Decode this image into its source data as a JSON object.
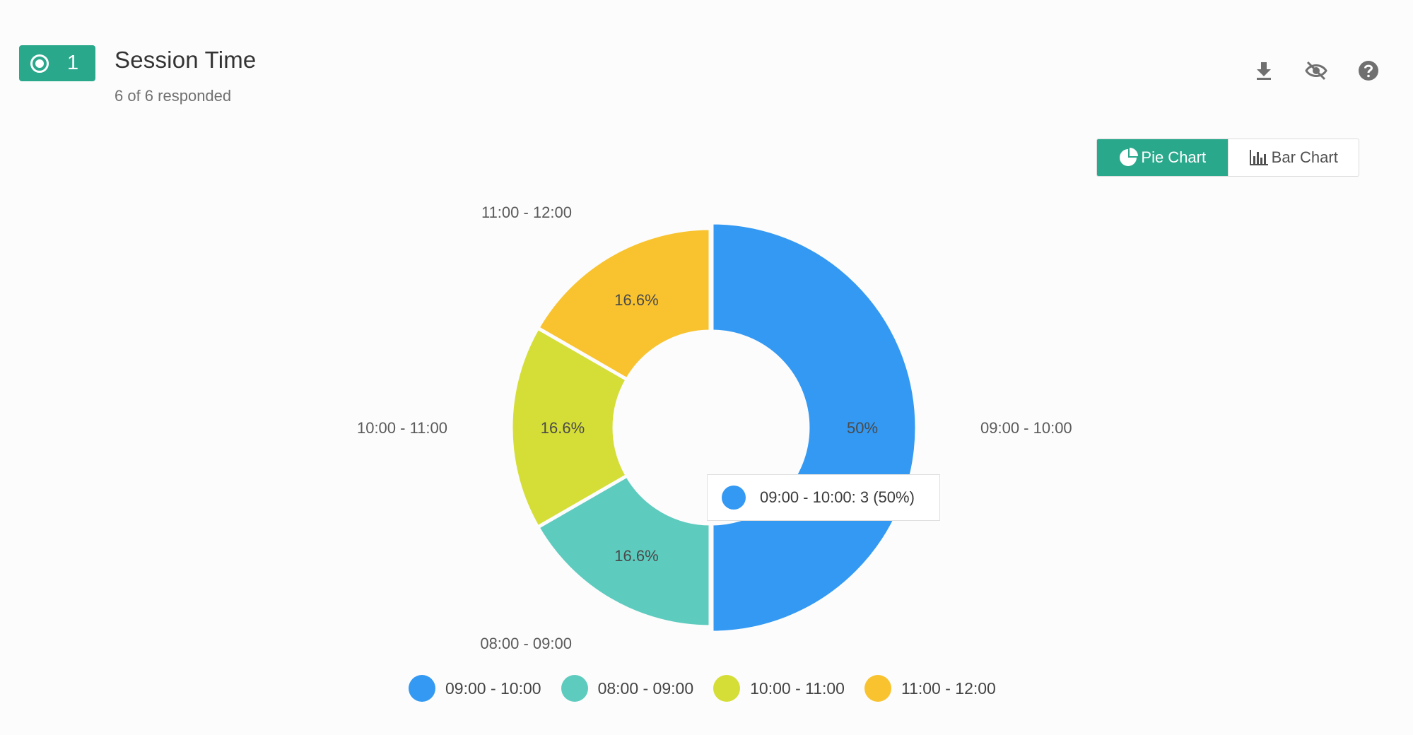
{
  "question": {
    "number": "1",
    "title": "Session Time",
    "subtitle": "6 of 6 responded"
  },
  "toolbar": {
    "icons": [
      "download-icon",
      "eye-off-icon",
      "help-icon"
    ],
    "color": "#707070"
  },
  "chart_toggle": {
    "pie_label": "Pie Chart",
    "bar_label": "Bar Chart",
    "active": "pie",
    "active_color": "#2aa88c"
  },
  "tooltip": {
    "text": "09:00 - 10:00: 3 (50%)",
    "color": "#3399f3"
  },
  "chart_data": {
    "type": "pie",
    "donut": true,
    "categories": [
      "09:00 - 10:00",
      "08:00 - 09:00",
      "10:00 - 11:00",
      "11:00 - 12:00"
    ],
    "values": [
      3,
      1,
      1,
      1
    ],
    "percent_labels": [
      "50%",
      "16.6%",
      "16.6%",
      "16.6%"
    ],
    "colors": [
      "#3399f3",
      "#5ecbbf",
      "#d5de36",
      "#f8c32f"
    ],
    "legend_position": "bottom",
    "highlighted": "09:00 - 10:00"
  }
}
